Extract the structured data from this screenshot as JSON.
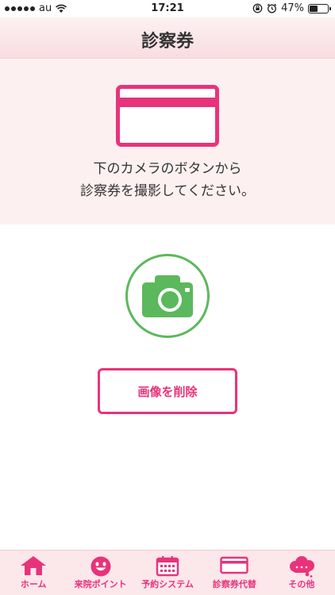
{
  "status_bar": {
    "carrier": "au",
    "time": "17:21",
    "battery_percent": "47%",
    "battery_level": 0.47,
    "icons": [
      "signal-dots-icon",
      "wifi-icon",
      "rotation-lock-icon",
      "alarm-icon",
      "battery-icon"
    ]
  },
  "header": {
    "title": "診察券"
  },
  "instructions": {
    "line1": "下のカメラのボタンから",
    "line2": "診察券を撮影してください。",
    "icon": "card-icon"
  },
  "camera": {
    "icon": "camera-icon",
    "color": "#5cb85c"
  },
  "actions": {
    "delete_label": "画像を削除"
  },
  "tab_bar": {
    "tabs": [
      {
        "label": "ホーム",
        "icon": "home-icon"
      },
      {
        "label": "来院ポイント",
        "icon": "smiley-icon"
      },
      {
        "label": "予約システム",
        "icon": "calendar-icon"
      },
      {
        "label": "診察券代替",
        "icon": "card-icon"
      },
      {
        "label": "その他",
        "icon": "cloud-icon"
      }
    ]
  },
  "colors": {
    "accent": "#e8337a",
    "camera_green": "#5cb85c",
    "panel_bg": "#fdf0f1",
    "tab_bg": "#fce7ea"
  }
}
